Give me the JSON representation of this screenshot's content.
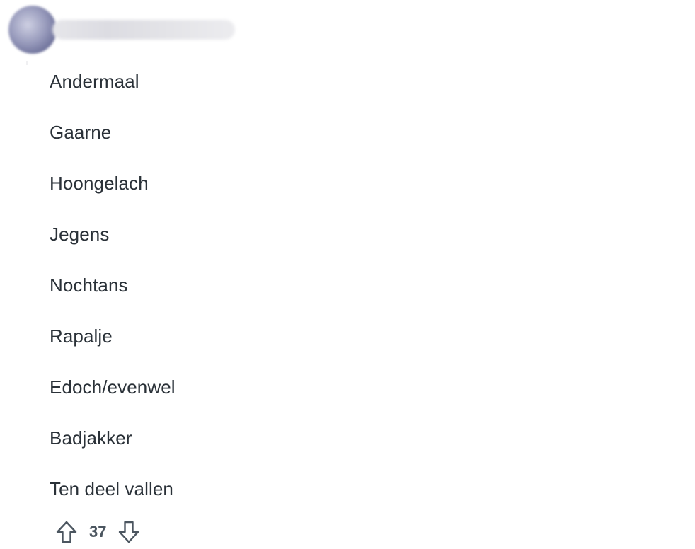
{
  "comment": {
    "body_lines": [
      "Andermaal",
      "Gaarne",
      "Hoongelach",
      "Jegens",
      "Nochtans",
      "Rapalje",
      "Edoch/evenwel",
      "Badjakker",
      "Ten deel vallen"
    ],
    "score": "37"
  },
  "icons": {
    "upvote": "arrow-up-outline-icon",
    "downvote": "arrow-down-outline-icon"
  },
  "colors": {
    "text": "#2a3138",
    "icon": "#4c5660",
    "background": "#ffffff"
  }
}
